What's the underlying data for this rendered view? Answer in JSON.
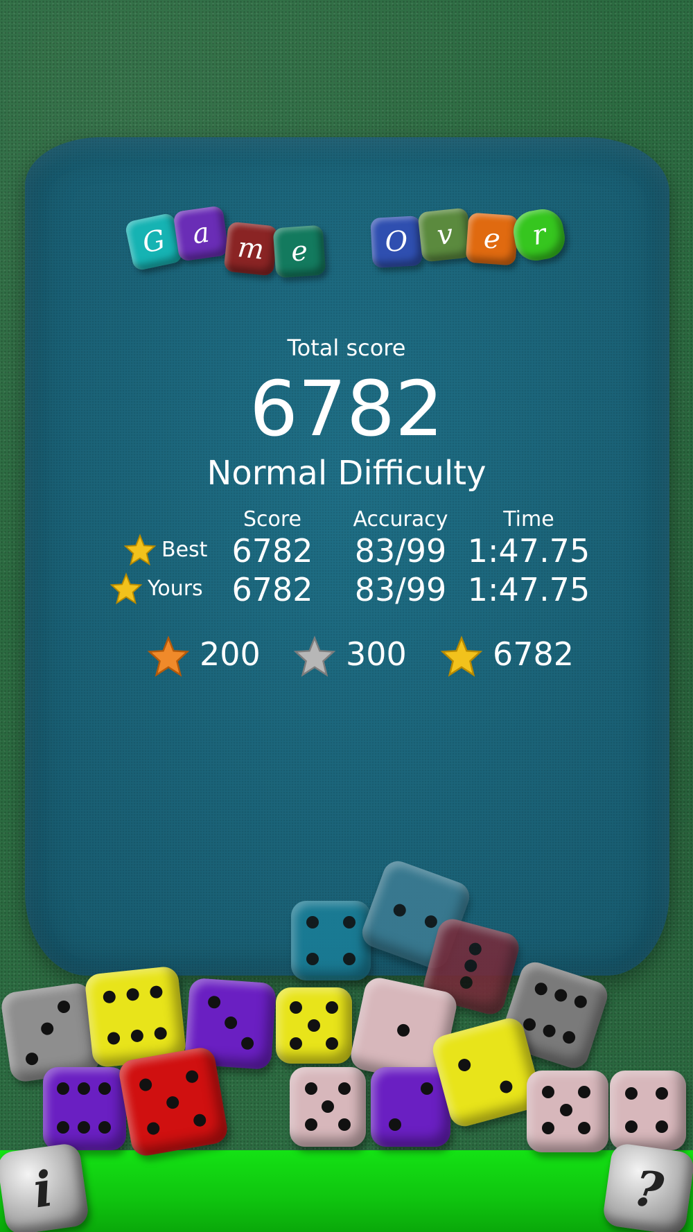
{
  "title": {
    "word1": [
      "G",
      "a",
      "m",
      "e"
    ],
    "word2": [
      "O",
      "v",
      "e",
      "r"
    ],
    "word1_colors": [
      "#16b3b3",
      "#6a2db6",
      "#8a2424",
      "#137a5e"
    ],
    "word2_colors": [
      "#2f4fb0",
      "#5b8a3e",
      "#e06a10",
      "#36c61f"
    ]
  },
  "summary": {
    "total_label": "Total score",
    "total_value": "6782",
    "difficulty": "Normal Difficulty"
  },
  "stats": {
    "headers": [
      "Score",
      "Accuracy",
      "Time"
    ],
    "rows": [
      {
        "label": "Best",
        "score": "6782",
        "accuracy": "83/99",
        "time": "1:47.75",
        "star": "gold-star-icon"
      },
      {
        "label": "Yours",
        "score": "6782",
        "accuracy": "83/99",
        "time": "1:47.75",
        "star": "gold-star-icon"
      }
    ]
  },
  "thresholds": [
    {
      "value": "200",
      "star": "bronze-star-icon",
      "color": "#f08a2a"
    },
    {
      "value": "300",
      "star": "silver-star-icon",
      "color": "#b7b7b7"
    },
    {
      "value": "6782",
      "star": "gold-star-icon",
      "color": "#f2c21c"
    }
  ],
  "colors": {
    "felt": "#2c6b41",
    "panel": "#1b6378",
    "floor": "#12d612",
    "text": "#ffffff"
  },
  "buttons": {
    "info": "i",
    "help": "?"
  }
}
